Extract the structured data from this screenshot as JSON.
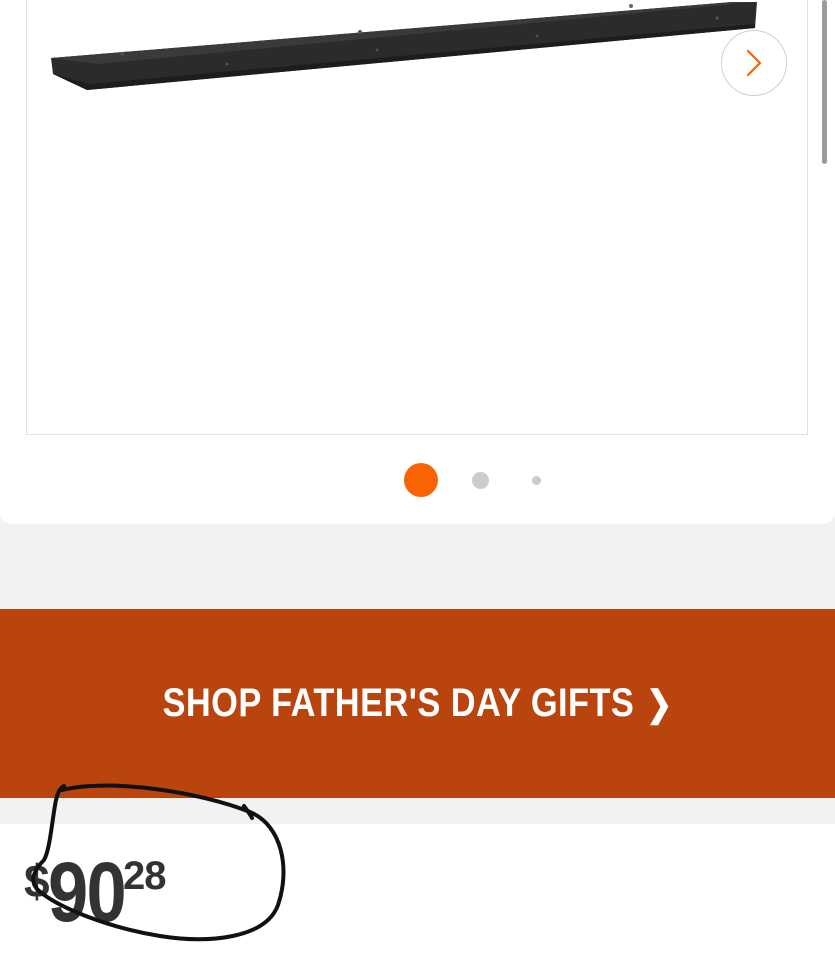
{
  "carousel": {
    "next_icon": "chevron-right-icon",
    "dots": [
      {
        "state": "active"
      },
      {
        "state": "inactive"
      },
      {
        "state": "inactive"
      }
    ],
    "active_index": 0,
    "accent_color": "#f96302"
  },
  "promo_banner": {
    "label": "SHOP FATHER'S DAY GIFTS",
    "chevron": "❯",
    "background_color": "#b9440d"
  },
  "price": {
    "currency": "$",
    "whole": "90",
    "cents": "28"
  }
}
